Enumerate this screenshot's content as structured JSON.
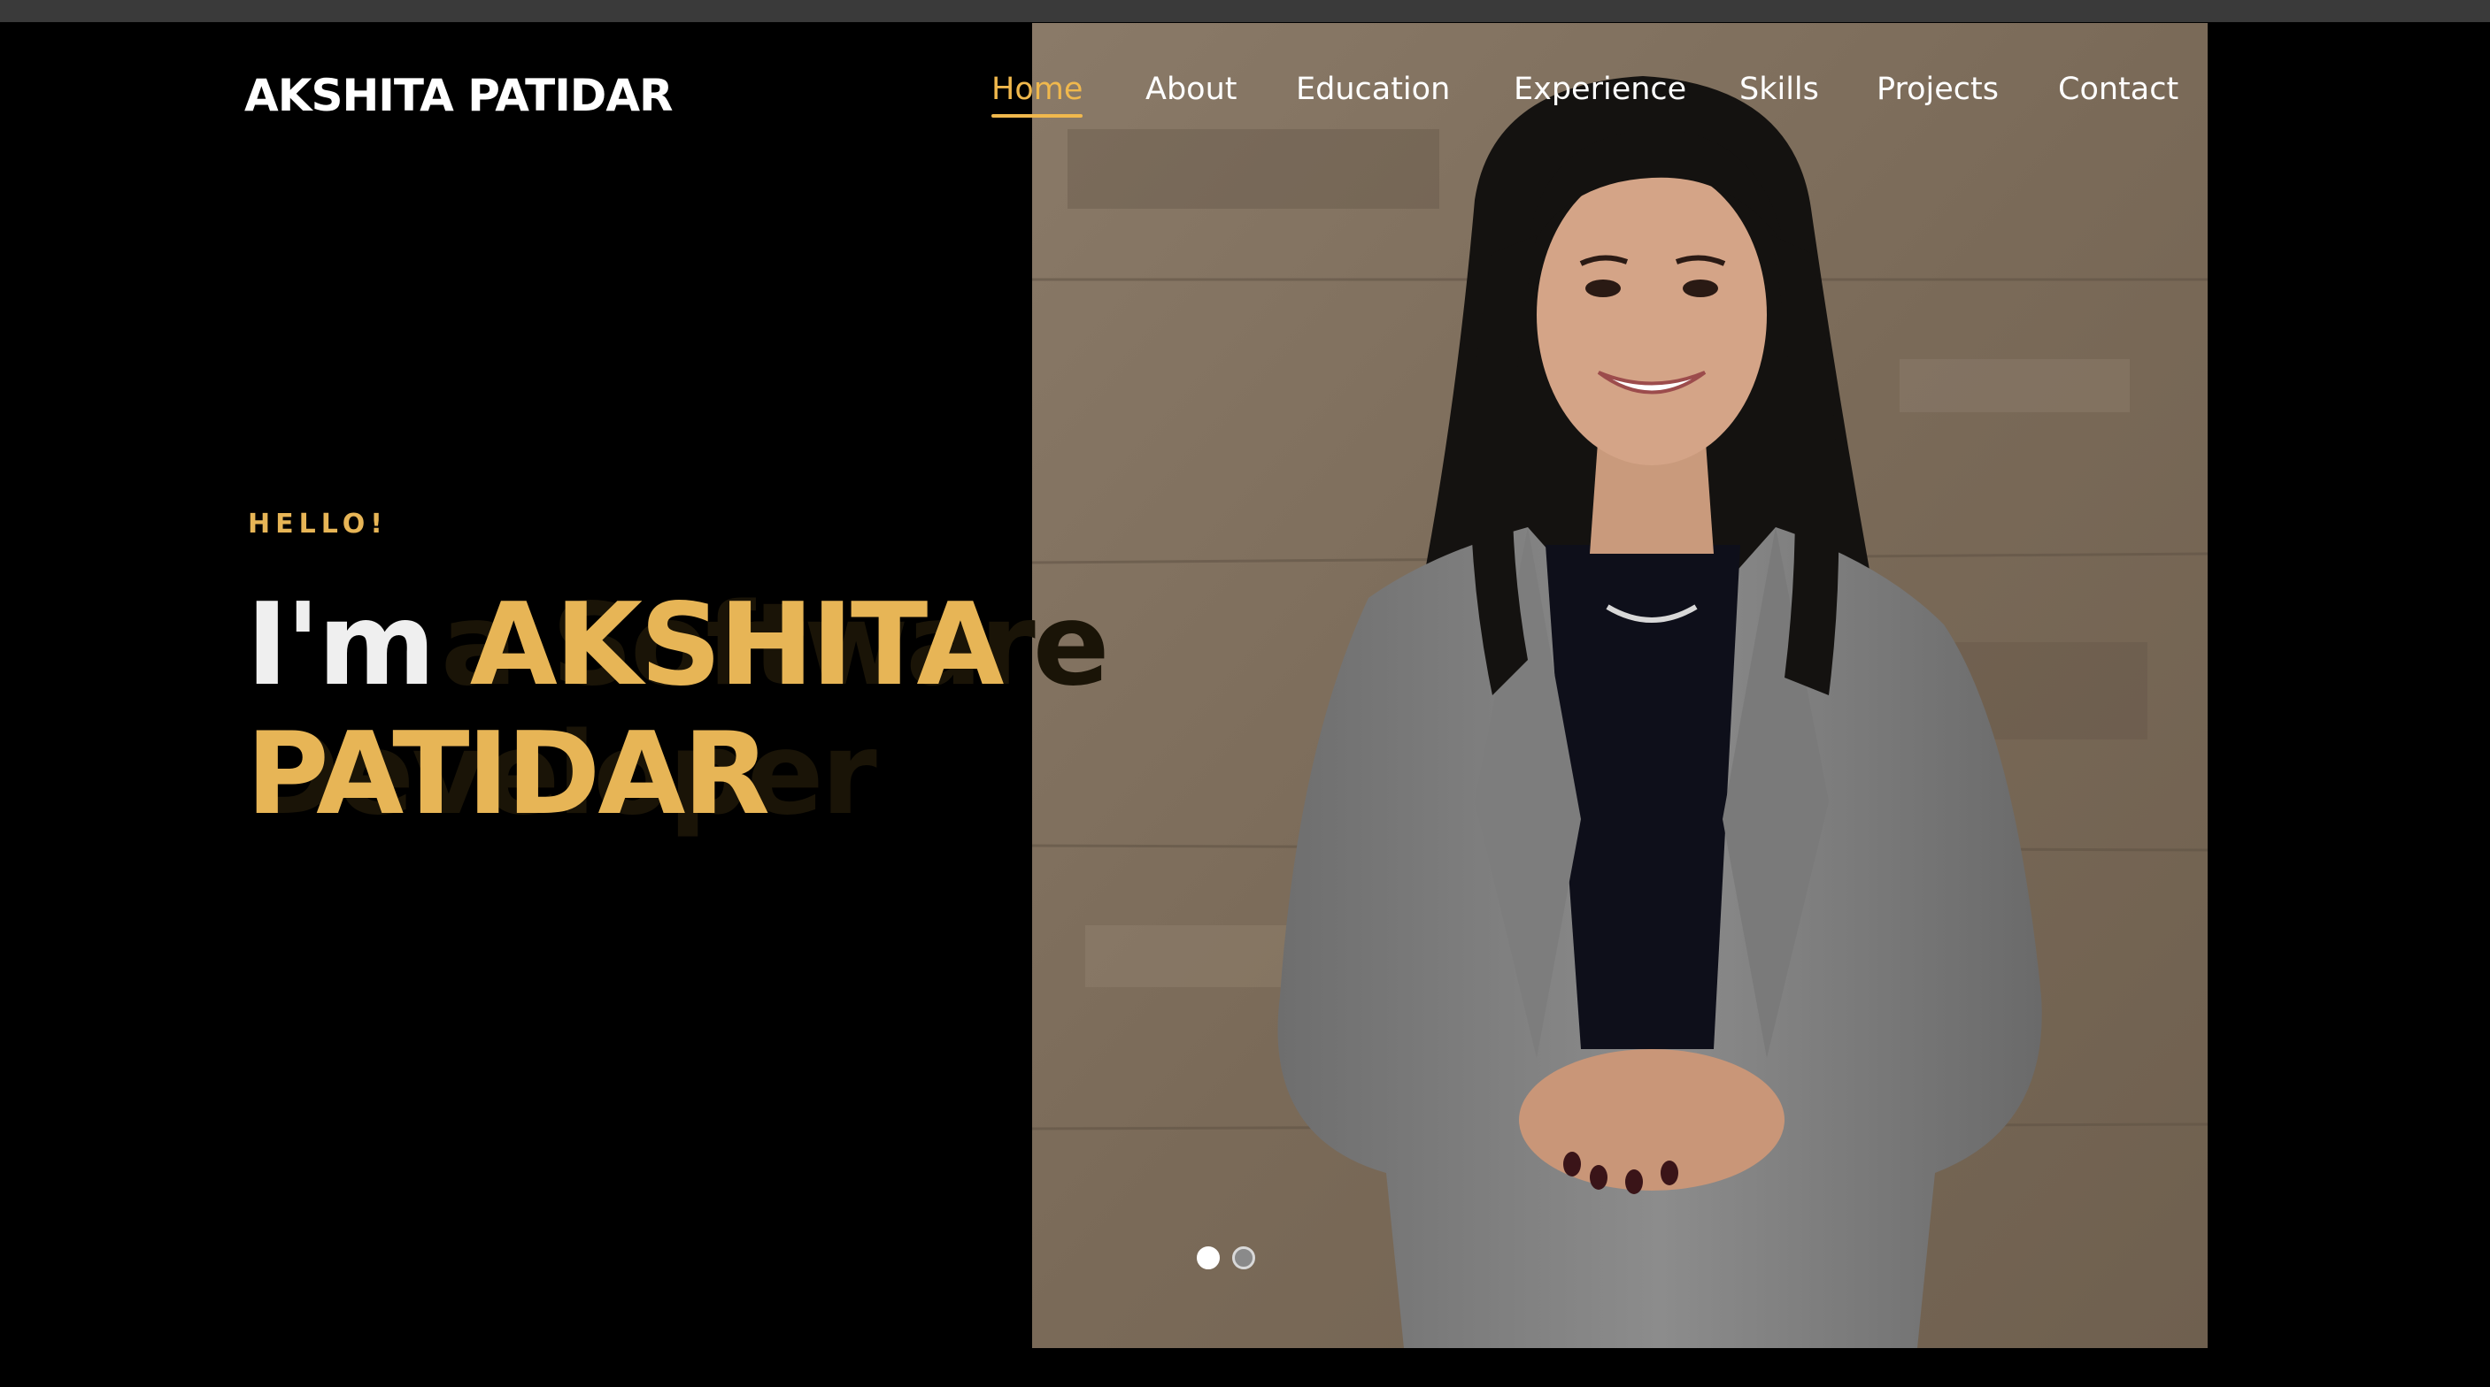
{
  "brand": {
    "name": "AKSHITA PATIDAR"
  },
  "nav": {
    "items": [
      {
        "label": "Home",
        "active": true
      },
      {
        "label": "About",
        "active": false
      },
      {
        "label": "Education",
        "active": false
      },
      {
        "label": "Experience",
        "active": false
      },
      {
        "label": "Skills",
        "active": false
      },
      {
        "label": "Projects",
        "active": false
      },
      {
        "label": "Contact",
        "active": false
      }
    ]
  },
  "hero": {
    "greeting": "HELLO!",
    "intro": "I'm",
    "name_line1": "AKSHITA",
    "name_line2": "PATIDAR",
    "ghost_line1": "a Software",
    "ghost_line2": "Developer"
  },
  "slider": {
    "dots": 2,
    "active_index": 0
  },
  "colors": {
    "accent": "#e7b556",
    "background": "#000000",
    "topbar": "#3a3a3a"
  }
}
